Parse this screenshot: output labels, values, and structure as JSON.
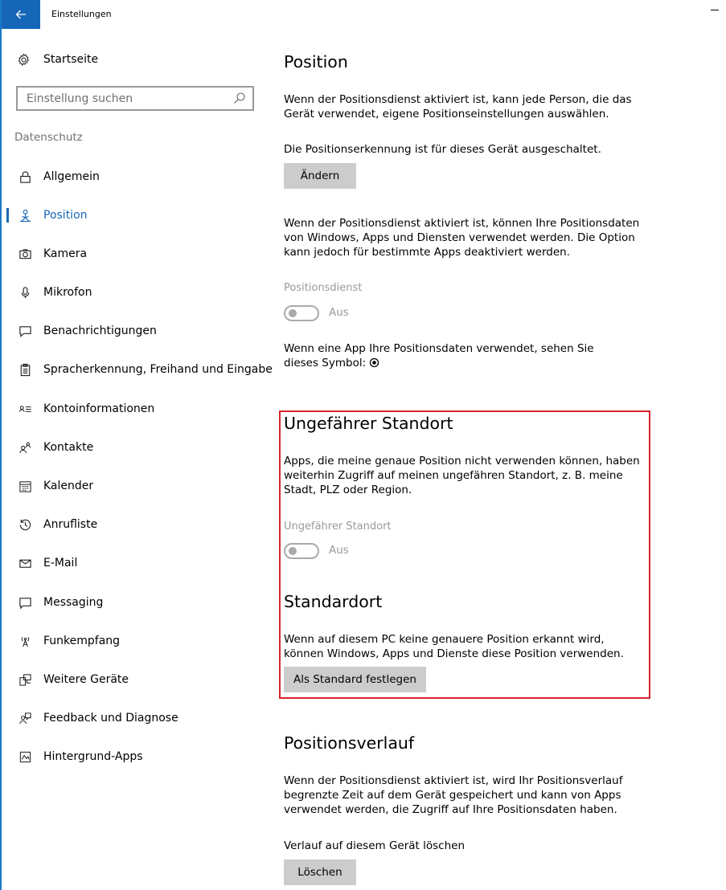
{
  "window": {
    "title": "Einstellungen"
  },
  "sidebar": {
    "home_label": "Startseite",
    "search_placeholder": "Einstellung suchen",
    "section_label": "Datenschutz",
    "items": [
      {
        "label": "Allgemein",
        "icon": "lock-icon"
      },
      {
        "label": "Position",
        "icon": "location-person-icon",
        "active": true
      },
      {
        "label": "Kamera",
        "icon": "camera-icon"
      },
      {
        "label": "Mikrofon",
        "icon": "microphone-icon"
      },
      {
        "label": "Benachrichtigungen",
        "icon": "notification-icon"
      },
      {
        "label": "Spracherkennung, Freihand und Eingabe",
        "icon": "clipboard-icon"
      },
      {
        "label": "Kontoinformationen",
        "icon": "account-info-icon"
      },
      {
        "label": "Kontakte",
        "icon": "contacts-icon"
      },
      {
        "label": "Kalender",
        "icon": "calendar-icon"
      },
      {
        "label": "Anrufliste",
        "icon": "call-history-icon"
      },
      {
        "label": "E-Mail",
        "icon": "mail-icon"
      },
      {
        "label": "Messaging",
        "icon": "message-icon"
      },
      {
        "label": "Funkempfang",
        "icon": "radio-antenna-icon"
      },
      {
        "label": "Weitere Geräte",
        "icon": "devices-icon"
      },
      {
        "label": "Feedback und Diagnose",
        "icon": "feedback-icon"
      },
      {
        "label": "Hintergrund-Apps",
        "icon": "background-apps-icon"
      }
    ]
  },
  "main": {
    "position": {
      "title": "Position",
      "intro": "Wenn der Positionsdienst aktiviert ist, kann jede Person, die das Gerät verwendet, eigene Positionseinstellungen auswählen.",
      "status": "Die Positionserkennung ist für dieses Gerät ausgeschaltet.",
      "change_button": "Ändern",
      "usage_text": "Wenn der Positionsdienst aktiviert ist, können Ihre Positionsdaten von Windows, Apps und Diensten verwendet werden. Die Option kann jedoch für bestimmte Apps deaktiviert werden.",
      "service_label": "Positionsdienst",
      "service_state": "Aus",
      "symbol_text": "Wenn eine App Ihre Positionsdaten verwendet, sehen Sie dieses Symbol:"
    },
    "approx": {
      "title": "Ungefährer Standort",
      "text": "Apps, die meine genaue Position nicht verwenden können, haben weiterhin Zugriff auf meinen ungefähren Standort, z. B. meine Stadt, PLZ oder Region.",
      "toggle_label": "Ungefährer Standort",
      "toggle_state": "Aus"
    },
    "default_location": {
      "title": "Standardort",
      "text": "Wenn auf diesem PC keine genauere Position erkannt wird, können Windows, Apps und Dienste diese Position verwenden.",
      "button": "Als Standard festlegen"
    },
    "history": {
      "title": "Positionsverlauf",
      "text": "Wenn der Positionsdienst aktiviert ist, wird Ihr Positionsverlauf begrenzte Zeit auf dem Gerät gespeichert und kann von Apps verwendet werden, die Zugriff auf Ihre Positionsdaten haben.",
      "clear_label": "Verlauf auf diesem Gerät löschen",
      "clear_button": "Löschen"
    }
  },
  "colors": {
    "accent": "#1667b6",
    "highlight": "#d9232e",
    "button_bg": "#cccccc",
    "disabled_text": "#9a9a9a"
  }
}
